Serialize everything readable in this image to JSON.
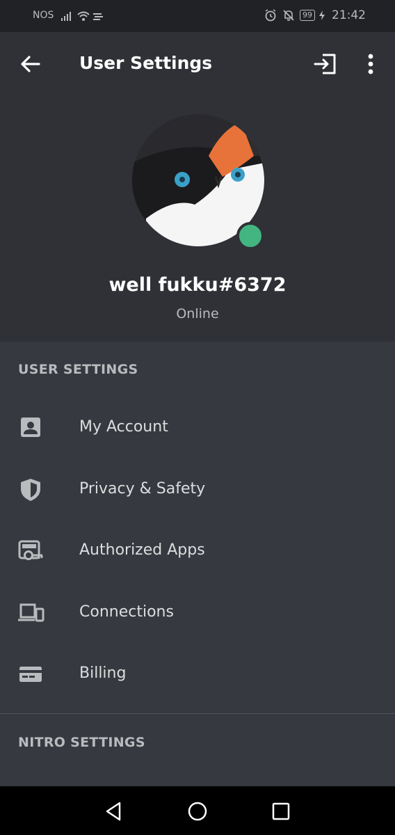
{
  "status_bar": {
    "carrier": "NOS",
    "battery": "99",
    "time": "21:42"
  },
  "header": {
    "title": "User Settings"
  },
  "profile": {
    "username": "well fukku#6372",
    "status": "Online"
  },
  "sections": {
    "user_settings": "USER SETTINGS",
    "nitro_settings": "NITRO SETTINGS"
  },
  "items": [
    {
      "label": "My Account",
      "icon": "account-icon"
    },
    {
      "label": "Privacy & Safety",
      "icon": "shield-icon"
    },
    {
      "label": "Authorized Apps",
      "icon": "authorized-apps-icon"
    },
    {
      "label": "Connections",
      "icon": "devices-icon"
    },
    {
      "label": "Billing",
      "icon": "credit-card-icon"
    }
  ],
  "colors": {
    "status_online": "#43b581",
    "background": "#36393f",
    "header_bg": "#2f3136"
  }
}
